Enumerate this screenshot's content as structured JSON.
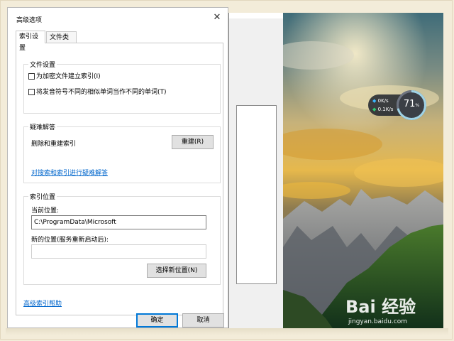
{
  "dialog": {
    "title": "高级选项",
    "close_glyph": "✕",
    "tabs": [
      {
        "label": "索引设置",
        "active": true
      },
      {
        "label": "文件类型",
        "active": false
      }
    ],
    "file_settings": {
      "title": "文件设置",
      "checkboxes": [
        {
          "label": "为加密文件建立索引(I)",
          "checked": false
        },
        {
          "label": "将发音符号不同的相似单词当作不同的单词(T)",
          "checked": false
        }
      ]
    },
    "troubleshooting": {
      "title": "疑难解答",
      "rebuild_text": "删除和重建索引",
      "rebuild_button": "重建(R)",
      "link": "对搜索和索引进行疑难解答"
    },
    "index_location": {
      "title": "索引位置",
      "current_label": "当前位置:",
      "current_value": "C:\\ProgramData\\Microsoft",
      "new_label": "新的位置(服务重新启动后):",
      "new_value": "",
      "select_button": "选择新位置(N)"
    },
    "help_link": "高级索引帮助",
    "ok_button": "确定",
    "cancel_button": "取消"
  },
  "net_widget": {
    "upload": "0K/s",
    "download": "0.1K/s",
    "usage_number": "71",
    "usage_unit": "%",
    "usage_fraction": 0.71,
    "colors": {
      "upload": "#39b7ff",
      "download": "#2ecc71",
      "gauge": "#9fd3e6"
    }
  },
  "watermark": {
    "main": "Bai 经验",
    "sub": "jingyan.baidu.com"
  }
}
